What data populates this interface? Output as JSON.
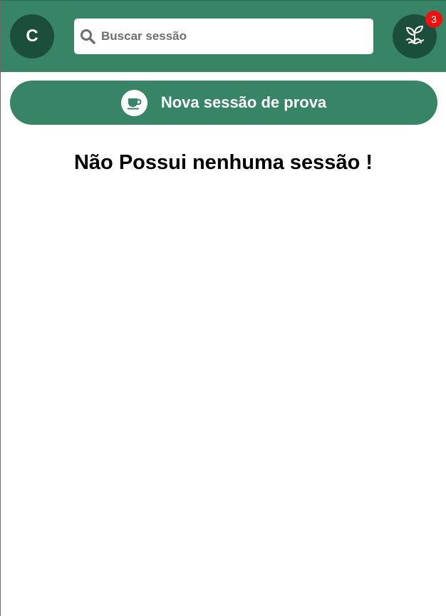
{
  "header": {
    "avatar_initial": "C",
    "search": {
      "placeholder": "Buscar sessão",
      "value": ""
    },
    "plant_icon": "seedling-icon",
    "notification_count": "3"
  },
  "actions": {
    "new_session_label": "Nova sessão de prova",
    "new_session_icon": "coffee-cup-icon"
  },
  "main": {
    "empty_message": "Não Possui nenhuma sessão !"
  },
  "colors": {
    "primary": "#388467",
    "dark": "#1c4f3b",
    "badge": "#ee1111"
  }
}
